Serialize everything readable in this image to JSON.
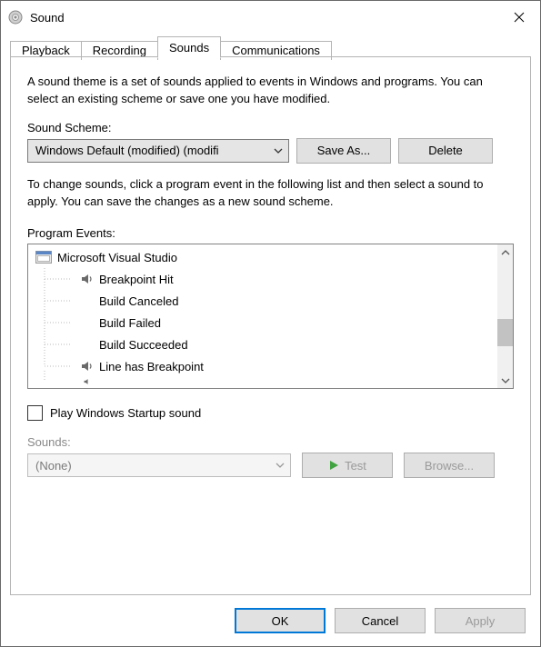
{
  "window": {
    "title": "Sound"
  },
  "tabs": {
    "playback": "Playback",
    "recording": "Recording",
    "sounds": "Sounds",
    "communications": "Communications"
  },
  "description": "A sound theme is a set of sounds applied to events in Windows and programs.  You can select an existing scheme or save one you have modified.",
  "scheme": {
    "label": "Sound Scheme:",
    "value": "Windows Default (modified) (modifi",
    "save_as": "Save As...",
    "delete": "Delete"
  },
  "description2": "To change sounds, click a program event in the following list and then select a sound to apply.  You can save the changes as a new sound scheme.",
  "events": {
    "label": "Program Events:",
    "root": "Microsoft Visual Studio",
    "items": [
      {
        "label": "Breakpoint Hit",
        "has_sound": true
      },
      {
        "label": "Build Canceled",
        "has_sound": false
      },
      {
        "label": "Build Failed",
        "has_sound": false
      },
      {
        "label": "Build Succeeded",
        "has_sound": false
      },
      {
        "label": "Line has Breakpoint",
        "has_sound": true
      }
    ]
  },
  "startup": {
    "label": "Play Windows Startup sound",
    "checked": false
  },
  "sounds": {
    "label": "Sounds:",
    "value": "(None)",
    "test": "Test",
    "browse": "Browse..."
  },
  "footer": {
    "ok": "OK",
    "cancel": "Cancel",
    "apply": "Apply"
  }
}
